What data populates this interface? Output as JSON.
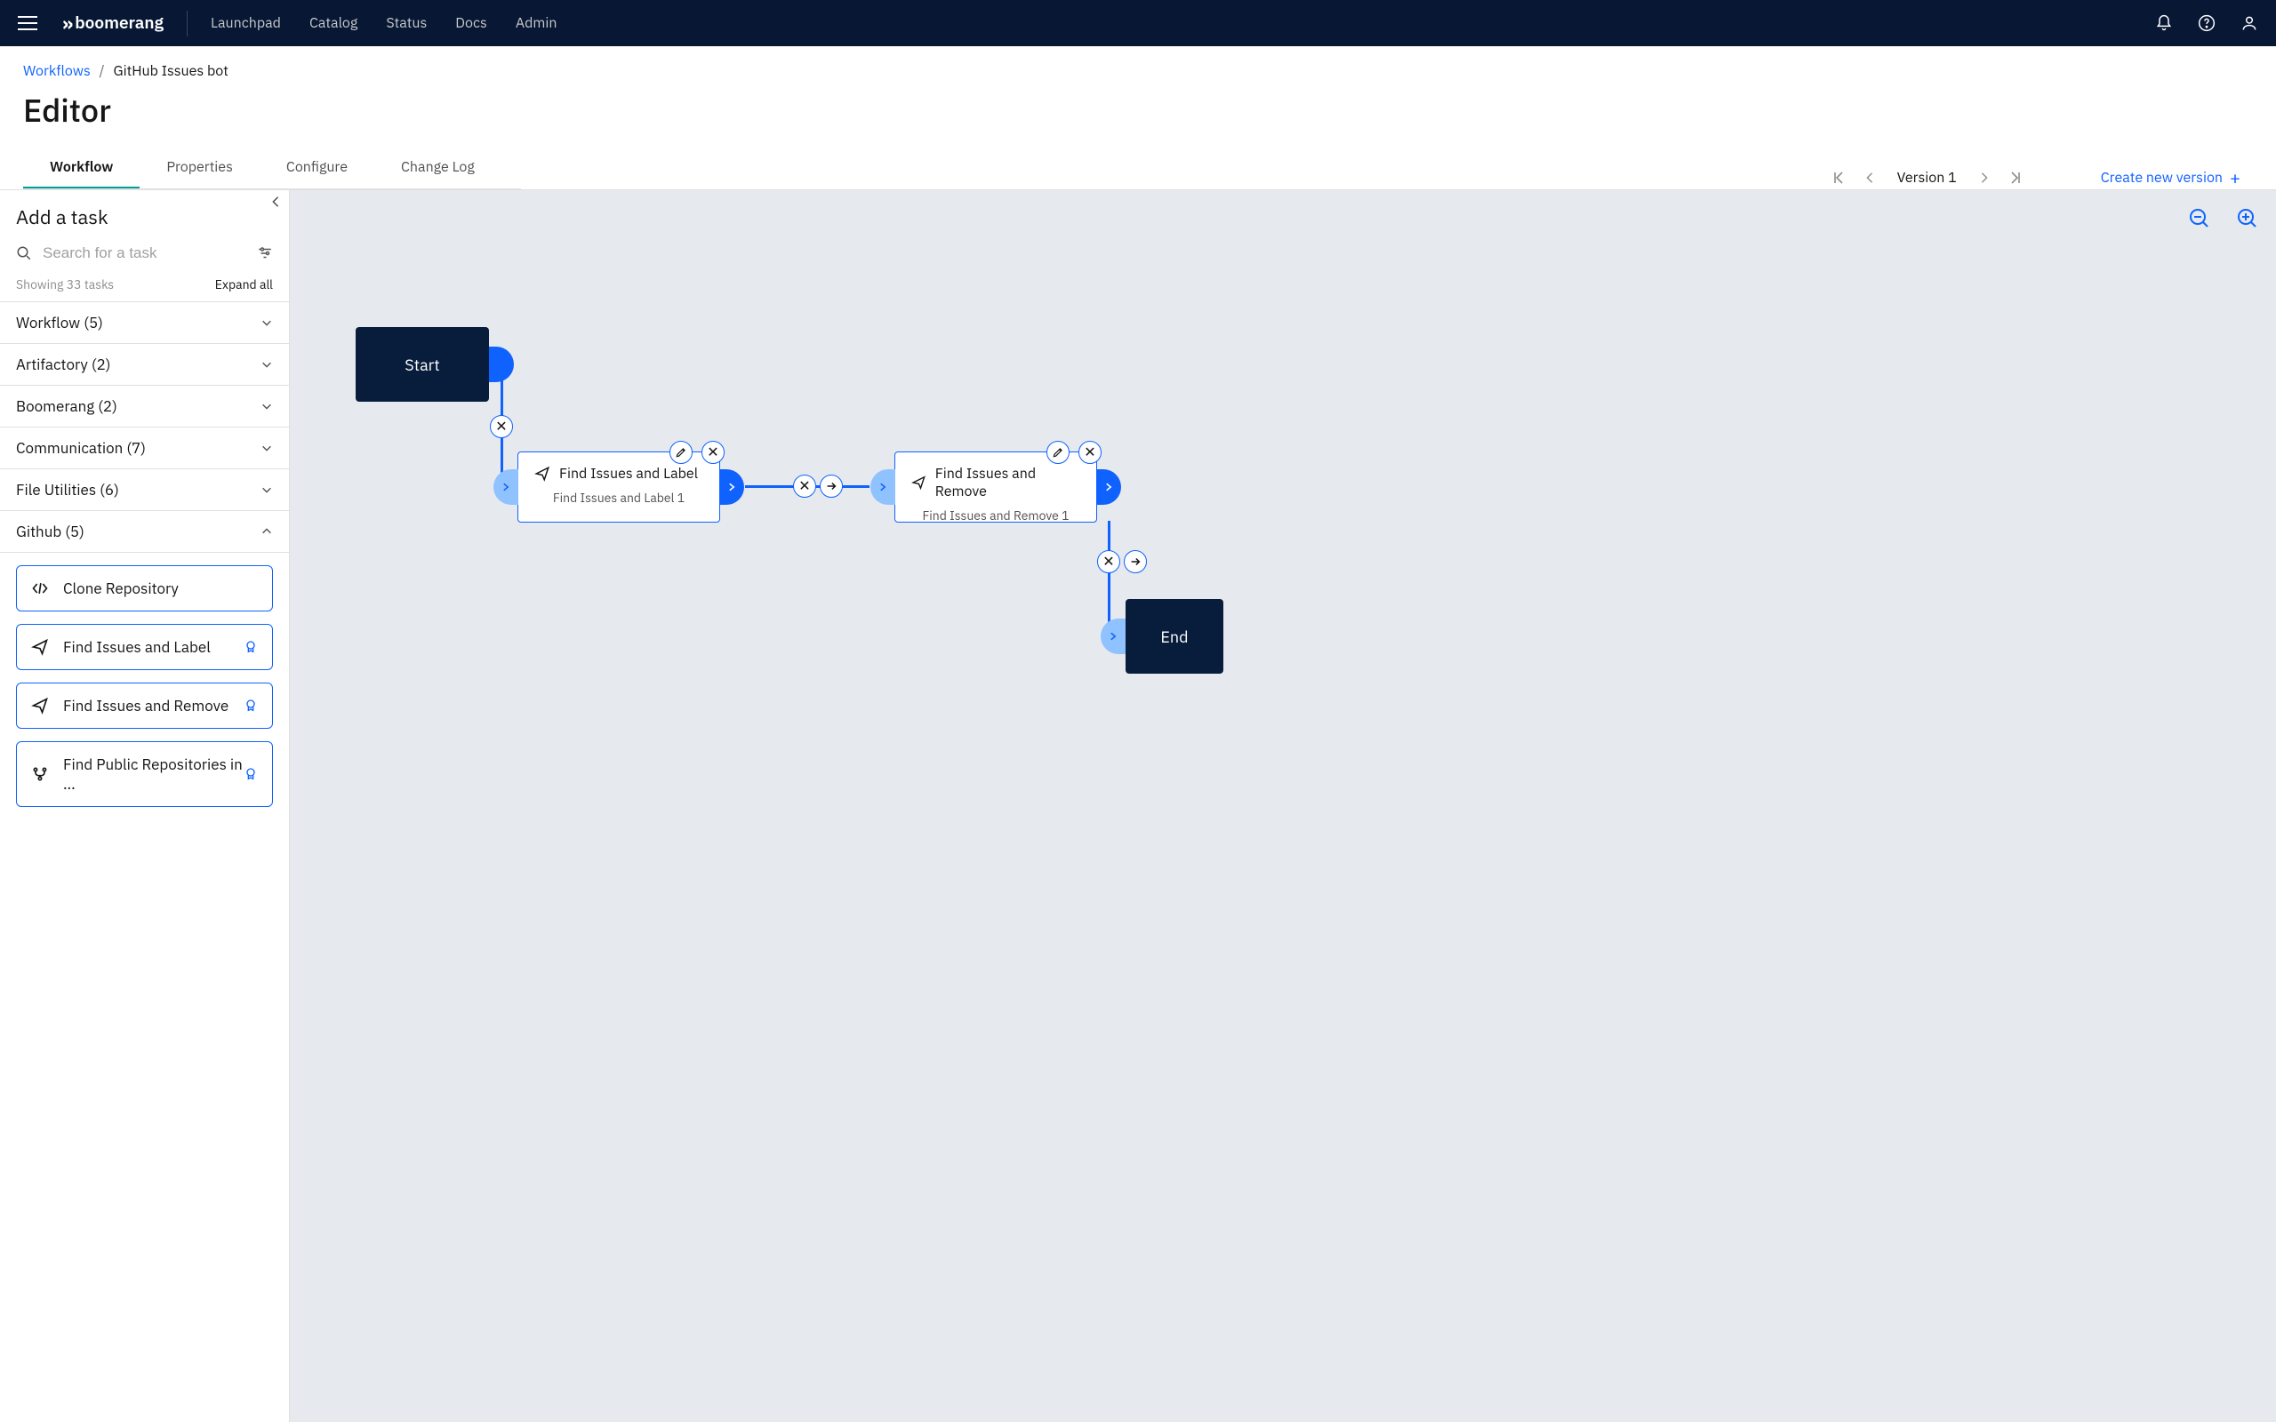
{
  "brand": "boomerang",
  "nav": [
    "Launchpad",
    "Catalog",
    "Status",
    "Docs",
    "Admin"
  ],
  "breadcrumb": {
    "root": "Workflows",
    "current": "GitHub Issues bot"
  },
  "page_title": "Editor",
  "tabs": [
    "Workflow",
    "Properties",
    "Configure",
    "Change Log"
  ],
  "active_tab": "Workflow",
  "version_label": "Version 1",
  "create_version": "Create new version",
  "sidebar": {
    "title": "Add a task",
    "search_placeholder": "Search for a task",
    "showing": "Showing 33 tasks",
    "expand": "Expand all",
    "categories": [
      {
        "label": "Workflow (5)",
        "open": false
      },
      {
        "label": "Artifactory (2)",
        "open": false
      },
      {
        "label": "Boomerang (2)",
        "open": false
      },
      {
        "label": "Communication (7)",
        "open": false
      },
      {
        "label": "File Utilities (6)",
        "open": false
      },
      {
        "label": "Github (5)",
        "open": true
      }
    ],
    "tasks": [
      {
        "label": "Clone Repository",
        "badge": false,
        "icon": "code"
      },
      {
        "label": "Find Issues and Label",
        "badge": true,
        "icon": "send"
      },
      {
        "label": "Find Issues and Remove",
        "badge": true,
        "icon": "send"
      },
      {
        "label": "Find Public Repositories in ...",
        "badge": true,
        "icon": "branch"
      }
    ]
  },
  "canvas": {
    "start": "Start",
    "end": "End",
    "node1": {
      "title": "Find Issues and Label",
      "sub": "Find Issues and Label 1"
    },
    "node2": {
      "title": "Find Issues and Remove",
      "sub": "Find Issues and Remove 1"
    }
  }
}
